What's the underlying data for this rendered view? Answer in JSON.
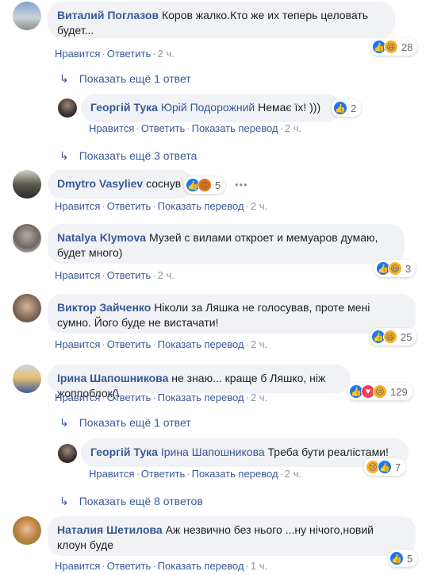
{
  "common": {
    "like": "Нравится",
    "reply": "Ответить",
    "translate": "Показать перевод",
    "sep": "·"
  },
  "comments": [
    {
      "author": "Виталий Поглазов",
      "text": "Коров жалко.Кто же их теперь целовать",
      "text2": "будет...",
      "time": "2 ч.",
      "count": "28"
    },
    {
      "more": "Показать ещё 1 ответ"
    },
    {
      "author": "Георгій Тука",
      "mention": "Юрій Подорожний",
      "text": "Немає їх! )))",
      "time": "2 ч.",
      "count": "2"
    },
    {
      "more": "Показать ещё 3 ответа"
    },
    {
      "author": "Dmytro Vasyliev",
      "text": "соснув",
      "time": "2 ч.",
      "count": "5"
    },
    {
      "author": "Natalya Klymova",
      "text": "Музей с вилами откроет и мемуаров думаю,",
      "text2": "будет много)",
      "time": "2 ч.",
      "count": "3"
    },
    {
      "author": "Виктор Зайченко",
      "text": "Ніколи за Ляшка не голосував, проте мені",
      "text2": "сумно. Його буде не вистачати!",
      "time": "2 ч.",
      "count": "25"
    },
    {
      "author": "Ірина Шапошникова",
      "text": "не знаю... краще б Ляшко, ніж жоппоблок(\\",
      "time": "2 ч.",
      "count": "129"
    },
    {
      "more": "Показать ещё 1 ответ"
    },
    {
      "author": "Георгій Тука",
      "mention": "Ірина Шапошникова",
      "text": "Треба бути реалістами!",
      "time": "2 ч.",
      "count": "7"
    },
    {
      "more": "Показать ещё 8 ответов"
    },
    {
      "author": "Наталия Шетилова",
      "text": "Аж незвично без нього ...ну нічого,новий",
      "text2": "клоун буде",
      "time": "1 ч.",
      "count": "5"
    }
  ],
  "colors": {
    "link": "#385898",
    "bubble": "#f0f2f5",
    "meta": "#90949c"
  }
}
